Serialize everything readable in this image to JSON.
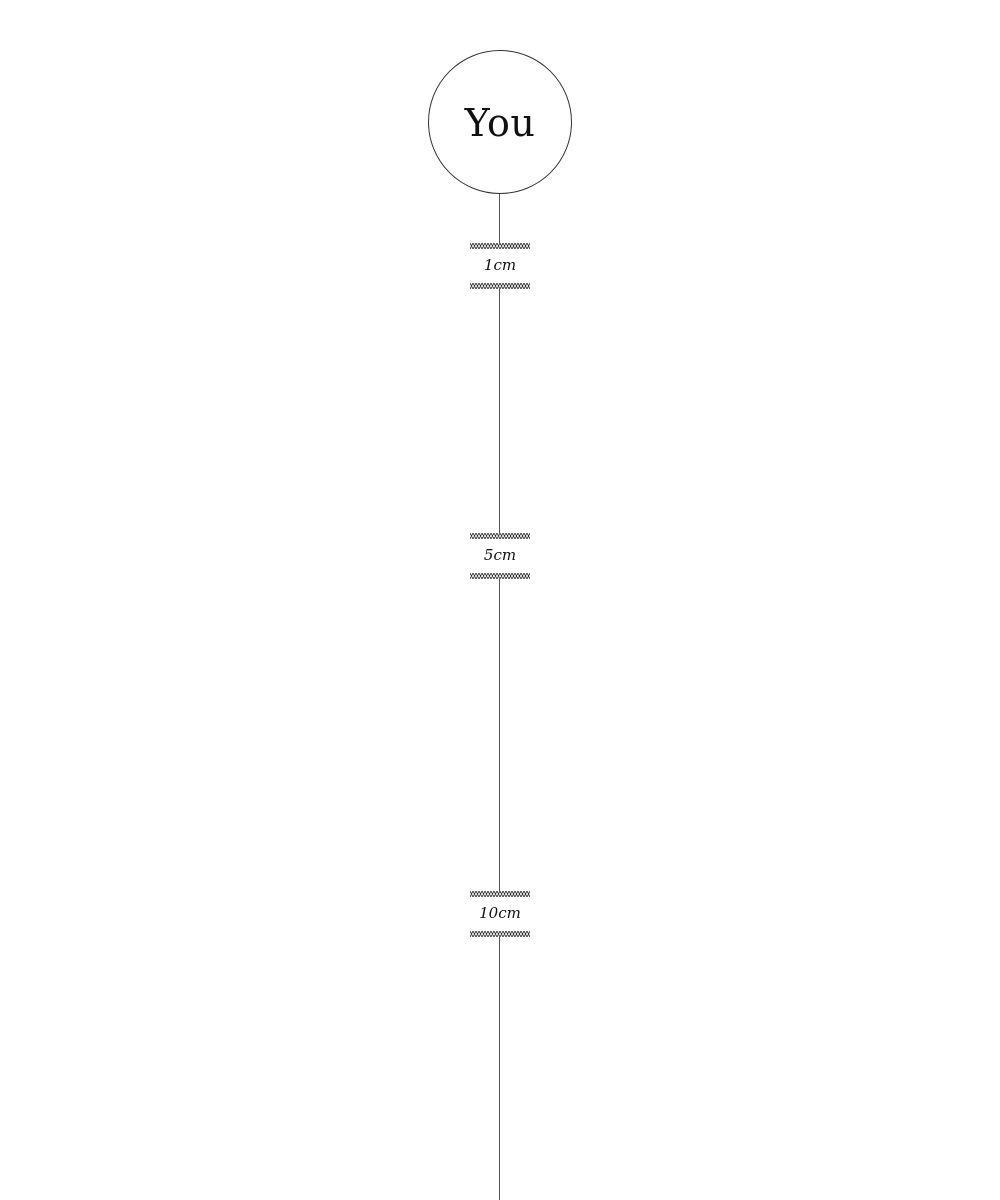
{
  "center": {
    "label": "You"
  },
  "markers": [
    {
      "label": "1cm"
    },
    {
      "label": "5cm"
    },
    {
      "label": "10cm"
    }
  ]
}
